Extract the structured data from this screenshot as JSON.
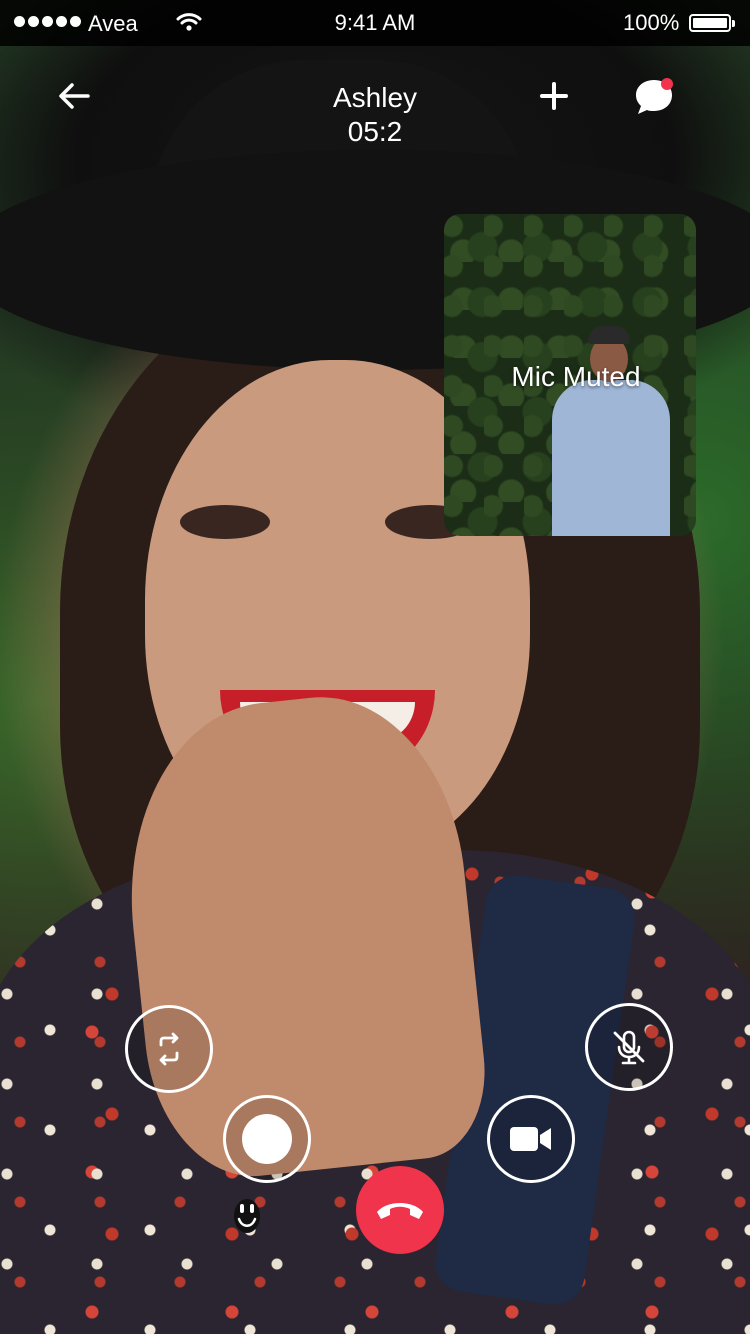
{
  "status_bar": {
    "carrier": "Avea",
    "time": "9:41 AM",
    "battery": "100%"
  },
  "call": {
    "name": "Ashley",
    "duration": "05:2"
  },
  "pip": {
    "status": "Mic Muted"
  },
  "icons": {
    "back": "arrow-left-icon",
    "add": "plus-icon",
    "chat": "chat-bubble-icon",
    "switch_camera": "switch-camera-icon",
    "mute": "mic-off-icon",
    "record": "record-icon",
    "video": "video-camera-icon",
    "end_call": "phone-hangup-icon",
    "emoji": "smiley-icon"
  },
  "colors": {
    "end_call": "#f0344b",
    "notification_dot": "#f0344b"
  }
}
